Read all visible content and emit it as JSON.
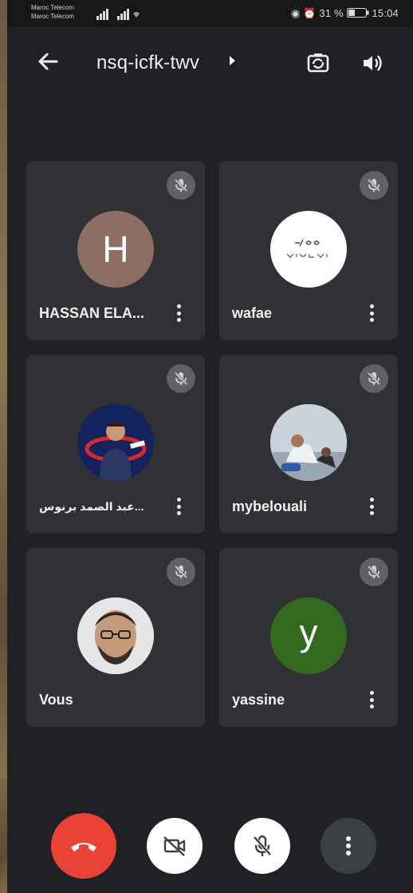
{
  "status_bar": {
    "carrier_1": "Maroc Telecom",
    "carrier_2": "Maroc Telecom",
    "signal_1": "4G",
    "battery_percent": "31 %",
    "time": "15:04"
  },
  "header": {
    "meeting_code": "nsq-icfk-twv",
    "back_icon": "arrow-left-icon",
    "camera_switch_icon": "camera-switch-icon",
    "audio_icon": "volume-icon"
  },
  "participants": [
    {
      "name": "HASSAN ELA...",
      "avatar_letter": "H",
      "avatar_color": "#8d6e63",
      "muted": true
    },
    {
      "name": "wafae",
      "avatar_letter": "",
      "avatar_color": "#ffffff",
      "muted": true
    },
    {
      "name": "...عبد الصمد برنوس",
      "avatar_letter": "",
      "avatar_color": "#1a2a6b",
      "muted": true
    },
    {
      "name": "mybelouali",
      "avatar_letter": "",
      "avatar_color": "#b8c6d4",
      "muted": true
    },
    {
      "name": "Vous",
      "avatar_letter": "",
      "avatar_color": "#d8d8d8",
      "muted": true
    },
    {
      "name": "yassine",
      "avatar_letter": "y",
      "avatar_color": "#33691e",
      "muted": true
    }
  ],
  "controls": {
    "end_call_icon": "phone-hangup-icon",
    "camera_off_icon": "camera-off-icon",
    "mic_off_icon": "mic-off-icon",
    "more_icon": "more-vertical-icon",
    "end_call_color": "#ea4335"
  }
}
